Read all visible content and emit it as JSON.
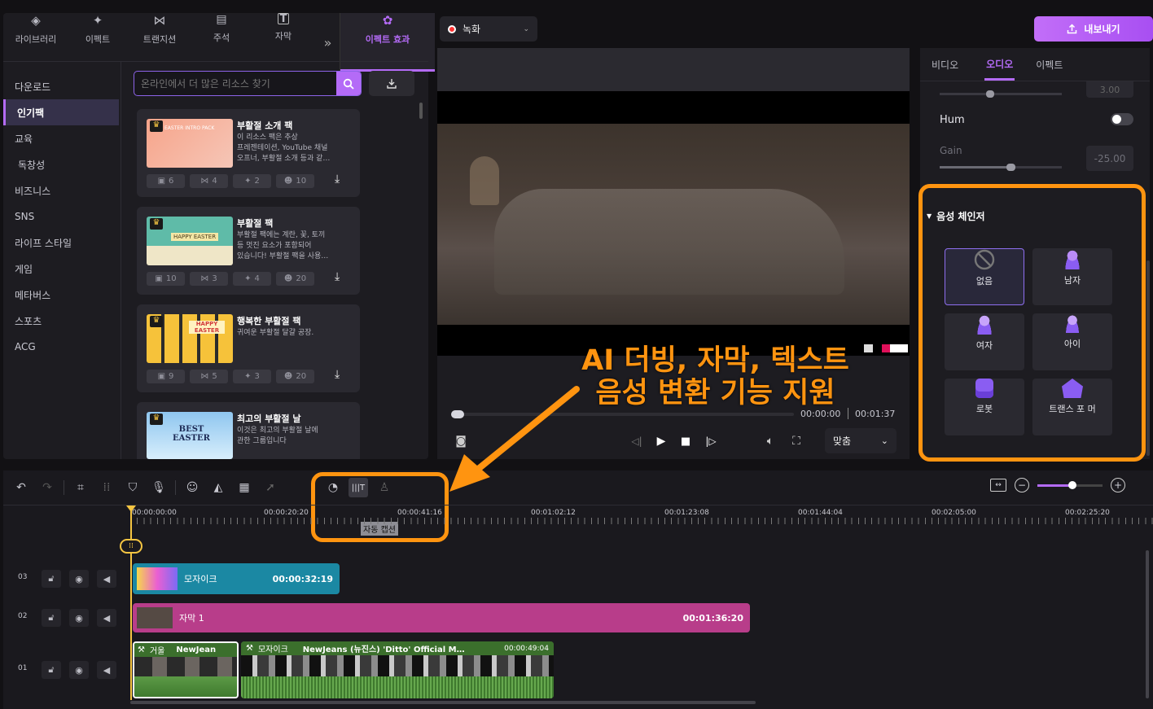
{
  "top_tabs": [
    {
      "label": "라이브러리",
      "icon": "layers-icon",
      "glyph": "◈"
    },
    {
      "label": "이펙트",
      "icon": "sparkle-icon",
      "glyph": "✦"
    },
    {
      "label": "트랜지션",
      "icon": "transition-icon",
      "glyph": "⋈"
    },
    {
      "label": "주석",
      "icon": "comment-icon",
      "glyph": "▤"
    },
    {
      "label": "자막",
      "icon": "caption-icon",
      "glyph": "T"
    },
    {
      "label": "이펙트 효과",
      "icon": "effect-pack-icon",
      "glyph": "✿"
    }
  ],
  "more_glyph": "»",
  "sidebar": {
    "items": [
      "다운로드",
      "인기팩",
      "교육",
      "독창성",
      "비즈니스",
      "SNS",
      "라이프 스타일",
      "게임",
      "메타버스",
      "스포츠",
      "ACG"
    ],
    "active": "인기팩"
  },
  "search": {
    "placeholder": "온라인에서 더 많은 리소스 찾기"
  },
  "packs": [
    {
      "title": "부활절 소개 팩",
      "desc": [
        "이 리소스 팩은 추상",
        "프레젠테이션, YouTube 채널",
        "오프너, 부활절 소개 등과 같…"
      ],
      "stats": [
        "6",
        "4",
        "2",
        "10"
      ],
      "thumb_text": "EASTER INTRO PACK",
      "bg": "#f7a48a"
    },
    {
      "title": "부활절 팩",
      "desc": [
        "부활절 팩에는 계란, 꽃, 토끼",
        "등 멋진 요소가 포함되어",
        "있습니다! 부활절 팩을 사용…"
      ],
      "stats": [
        "10",
        "3",
        "4",
        "20"
      ],
      "thumb_text": "HAPPY EASTER",
      "bg": "#5fbba8"
    },
    {
      "title": "행복한 부활절 팩",
      "desc": [
        "귀여운 부활절 달걀 공장."
      ],
      "stats": [
        "9",
        "5",
        "3",
        "20"
      ],
      "thumb_text": "HAPPY EASTER",
      "bg": "#f6c23a"
    },
    {
      "title": "최고의 부활절 날",
      "desc": [
        "이것은 최고의 부활절 날에",
        "관한 그룹입니다"
      ],
      "stats": [],
      "thumb_text": "BEST EASTER",
      "bg": "#8fc6ef"
    }
  ],
  "preview": {
    "record_label": "녹화",
    "time_current": "00:00:00",
    "time_total": "00:01:37",
    "fit_label": "맞춤"
  },
  "export_label": "내보내기",
  "right_tabs": [
    "비디오",
    "오디오",
    "이펙트"
  ],
  "right_active": "오디오",
  "audio": {
    "top_value": "3.00",
    "hum_label": "Hum",
    "gain_label": "Gain",
    "gain_value": "-25.00"
  },
  "voice_changer": {
    "title": "음성 체인저",
    "options": [
      {
        "label": "없음",
        "icon": "none-icon"
      },
      {
        "label": "남자",
        "icon": "man-icon"
      },
      {
        "label": "여자",
        "icon": "woman-icon"
      },
      {
        "label": "아이",
        "icon": "child-icon"
      },
      {
        "label": "로봇",
        "icon": "robot-icon"
      },
      {
        "label": "트랜스 포 머",
        "icon": "transformer-icon"
      }
    ]
  },
  "overlay_text": [
    "AI 더빙, 자막, 텍스트",
    "음성 변환 기능 지원"
  ],
  "ruler": [
    "00:00:00:00",
    "00:00:20:20",
    "00:00:41:16",
    "00:01:02:12",
    "00:01:23:08",
    "00:01:44:04",
    "00:02:05:00",
    "00:02:25:20"
  ],
  "tooltip": "자동 캡션",
  "tracks": [
    {
      "num": "03",
      "clip_label": "모자이크",
      "clip_time": "00:00:32:19"
    },
    {
      "num": "02",
      "clip_label": "자막 1",
      "clip_time": "00:01:36:20"
    },
    {
      "num": "01",
      "clip_a": "거울",
      "clip_a2": "NewJean",
      "clip_b": "모자이크",
      "clip_b2": "NewJeans (뉴진스) 'Ditto' Official M…",
      "clip_b_time": "00:00:49:04"
    }
  ],
  "colors": {
    "accent": "#b46bf7",
    "orange": "#ff9410",
    "teal": "#1b88a3",
    "magenta": "#b83d8a",
    "green": "#4e8f3a"
  }
}
